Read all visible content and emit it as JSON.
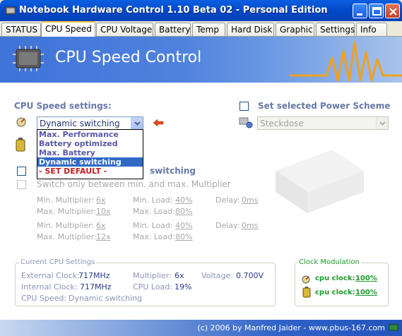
{
  "window": {
    "title": "Notebook Hardware Control 1.10 Beta 02  - Personal Edition"
  },
  "tabs": [
    {
      "label": "STATUS"
    },
    {
      "label": "CPU Speed"
    },
    {
      "label": "CPU Voltage"
    },
    {
      "label": "Battery"
    },
    {
      "label": "Temp"
    },
    {
      "label": "Hard Disk"
    },
    {
      "label": "Graphic"
    },
    {
      "label": "Settings"
    },
    {
      "label": "Info"
    }
  ],
  "active_tab": "CPU Speed",
  "banner": {
    "title": "CPU Speed Control"
  },
  "cpu_speed": {
    "section_label": "CPU Speed settings:",
    "selected": "Dynamic switching",
    "dropdown_options": [
      "Max. Performance",
      "Battery optimized",
      "Max. Battery",
      "Dynamic switching",
      " - SET DEFAULT -"
    ],
    "dynamic_switching_label": "switching",
    "switch_only_label": "Switch only between min. and max. Multiplier"
  },
  "power_scheme": {
    "label": "Set selected Power Scheme",
    "value": "Steckdose"
  },
  "multiplier_rows": [
    {
      "min_mult_label": "Min. Multiplier:",
      "min_mult": "6x",
      "min_load_label": "Min. Load:",
      "min_load": "40%",
      "delay_label": "Delay:",
      "delay": "0ms"
    },
    {
      "max_mult_label": "Max. Multiplier:",
      "max_mult": "10x",
      "max_load_label": "Max. Load:",
      "max_load": "80%"
    },
    {
      "min_mult_label": "Min. Multiplier:",
      "min_mult": "6x",
      "min_load_label": "Min. Load:",
      "min_load": "40%",
      "delay_label": "Delay:",
      "delay": "0ms"
    },
    {
      "max_mult_label": "Max. Multiplier:",
      "max_mult": "12x",
      "max_load_label": "Max. Load:",
      "max_load": "80%"
    }
  ],
  "current_cpu": {
    "group_title": "Current CPU Settings",
    "external_clock_label": "External Clock:",
    "external_clock": "717MHz",
    "internal_clock_label": "Internal Clock:",
    "internal_clock": "717MHz",
    "multiplier_label": "Multiplier:",
    "multiplier": "6x",
    "cpu_load_label": "CPU Load:",
    "cpu_load": "19%",
    "voltage_label": "Voltage:",
    "voltage": "0.700V",
    "cpu_speed_label": "CPU Speed:",
    "cpu_speed": "Dynamic switching"
  },
  "clock_modulation": {
    "group_title": "Clock Modulation",
    "rows": [
      {
        "label": "cpu clock:",
        "value": "100%"
      },
      {
        "label": "cpu clock:",
        "value": "100%"
      }
    ]
  },
  "footer": {
    "text": "(c) 2006 by Manfred Jaider  -  www.pbus-167.com"
  },
  "colors": {
    "title_bar": "#0249C8",
    "banner": "#4F82DE",
    "section_label": "#6879A8",
    "dropdown_selected": "#316AC5",
    "clock_green": "#1E9A2C"
  }
}
